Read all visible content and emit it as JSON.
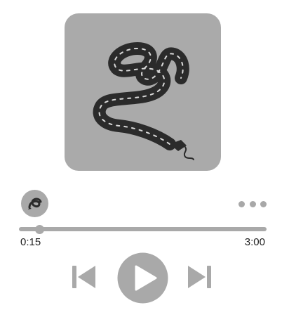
{
  "player": {
    "current_time": "0:15",
    "total_time": "3:00",
    "progress_fraction": 0.0833
  },
  "colors": {
    "artwork_bg": "#aaaaaa",
    "control_gray": "#a9a9a9",
    "snake": "#2b2b2b",
    "time_text": "#222222"
  },
  "icons": {
    "artwork": "snake-illustration",
    "avatar": "artist-avatar",
    "more": "more-horizontal-icon",
    "previous": "skip-previous-icon",
    "play": "play-icon",
    "next": "skip-next-icon"
  }
}
